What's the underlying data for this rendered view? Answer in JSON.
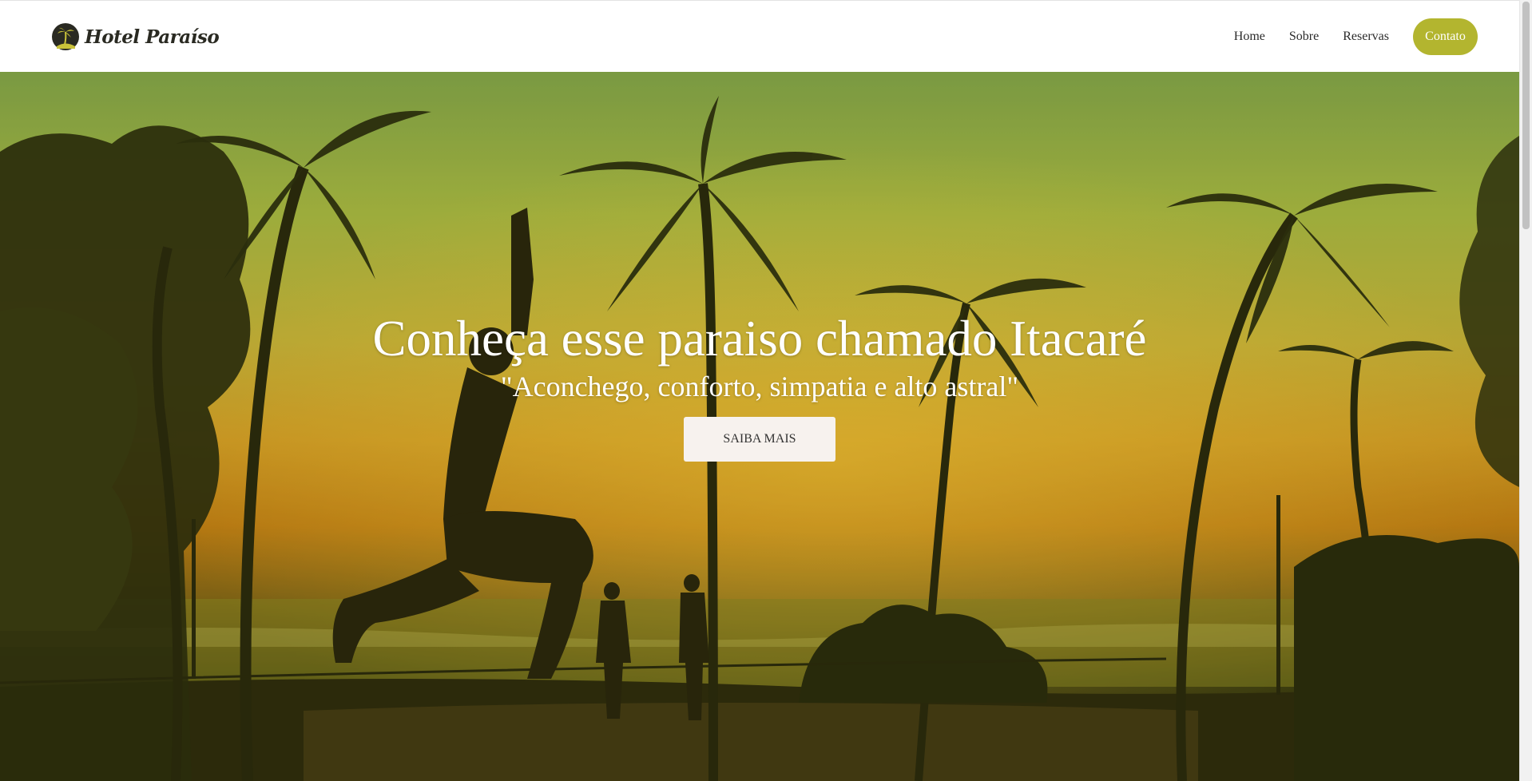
{
  "header": {
    "brand_name": "Hotel Paraíso",
    "logo_icon": "palm-tree-logo-icon",
    "nav": {
      "home": "Home",
      "sobre": "Sobre",
      "reservas": "Reservas",
      "contato": "Contato"
    }
  },
  "hero": {
    "title": "Conheça esse paraiso chamado Itacaré",
    "subtitle": "\"Aconchego, conforto, simpatia e alto astral\"",
    "button_label": "SAIBA MAIS",
    "background": "sunset-beach-palms-photo"
  },
  "colors": {
    "accent": "#b3b52f",
    "header_bg": "#ffffff",
    "button_bg": "#f7f2ee"
  }
}
